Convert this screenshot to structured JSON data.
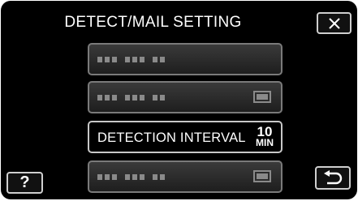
{
  "header": {
    "title": "DETECT/MAIL SETTING"
  },
  "toolbar": {
    "close_icon": "close-x-icon",
    "help_label": "?",
    "back_icon": "return-arrow-icon"
  },
  "menu": {
    "items": [
      {
        "state": "disabled"
      },
      {
        "state": "disabled"
      },
      {
        "label": "DETECTION INTERVAL",
        "value": "10",
        "unit": "MIN",
        "state": "enabled"
      },
      {
        "state": "disabled"
      }
    ]
  },
  "colors": {
    "background": "#000000",
    "text": "#ffffff",
    "disabled": "#8a8a8a",
    "border": "#c8c8c8"
  }
}
